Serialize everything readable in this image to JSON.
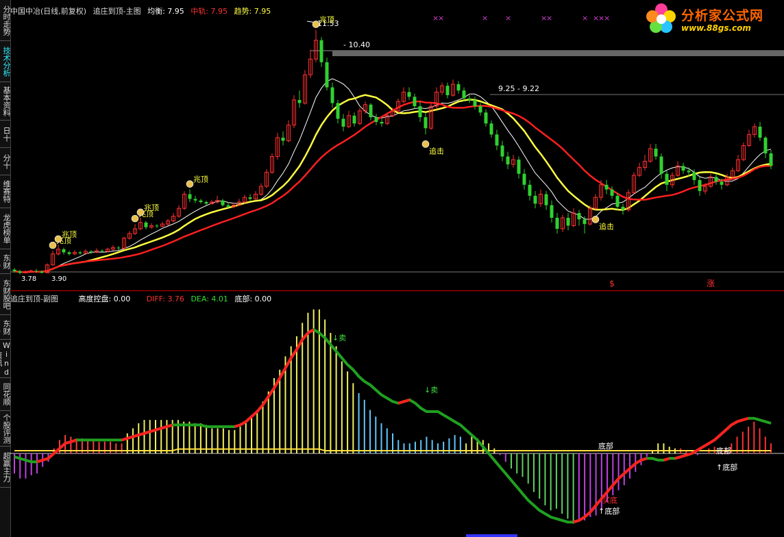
{
  "sidebar": {
    "items": [
      {
        "label": "分时走势",
        "active": false
      },
      {
        "label": "技术分析",
        "active": true
      },
      {
        "label": "基本资料",
        "active": false
      },
      {
        "label": "日十",
        "active": false
      },
      {
        "label": "分十",
        "active": false
      },
      {
        "label": "维赛特",
        "active": false
      },
      {
        "label": "龙虎榜单",
        "active": false
      },
      {
        "label": "东财10",
        "active": false
      },
      {
        "label": "东财股吧",
        "active": false
      },
      {
        "label": "东财F9",
        "active": false
      },
      {
        "label": "Wind资讯",
        "active": false
      },
      {
        "label": "同花顺",
        "active": false
      },
      {
        "label": "个股评测",
        "active": false
      },
      {
        "label": "超赢主力",
        "active": false
      }
    ]
  },
  "main_header": {
    "stock": "中国中冶(日线,前复权)",
    "indicator": "追庄到顶-主图",
    "avg_label": "均衡:",
    "avg_value": "7.95",
    "mid_label": "中轨:",
    "mid_value": "7.95",
    "trend_label": "趋势:",
    "trend_value": "7.95"
  },
  "sub_header": {
    "indicator": "追庄到顶-副图",
    "control_label": "高度控盘:",
    "control_value": "0.00",
    "diff_label": "DIFF:",
    "diff_value": "3.76",
    "dea_label": "DEA:",
    "dea_value": "4.01",
    "bottom_label": "底部:",
    "bottom_value": "0.00"
  },
  "logo": {
    "title": "分析家公式网",
    "url": "www.88gs.com"
  },
  "colors": {
    "up": "#ff3030",
    "down": "#30d030",
    "yellow": "#ffff40",
    "white": "#ffffff",
    "red": "#ff2020",
    "cyan": "#40c0ff",
    "magenta": "#d040d0",
    "grid": "#888888"
  },
  "chart_data": [
    {
      "type": "candlestick",
      "title": "追庄到顶-主图",
      "ylim": [
        3.5,
        12.0
      ],
      "price_markers": [
        {
          "text": "11.53"
        },
        {
          "text": "- 10.40"
        },
        {
          "text": "9.25 - 9.22"
        },
        {
          "text": "3.78"
        },
        {
          "text": "3.90"
        }
      ],
      "signals": [
        {
          "text": "兆顶",
          "idx": 7
        },
        {
          "text": "兆顶",
          "idx": 8
        },
        {
          "text": "兆顶",
          "idx": 22
        },
        {
          "text": "兆顶",
          "idx": 23
        },
        {
          "text": "兆顶",
          "idx": 32
        },
        {
          "text": "兆顶",
          "idx": 55
        },
        {
          "text": "追击",
          "idx": 75
        },
        {
          "text": "追击",
          "idx": 106
        }
      ],
      "bottom_flags": [
        {
          "text": "$",
          "idx": 109
        },
        {
          "text": "涨",
          "idx": 127
        }
      ],
      "candles": [
        [
          3.9,
          3.85,
          3.95,
          3.8
        ],
        [
          3.85,
          3.8,
          3.9,
          3.75
        ],
        [
          3.8,
          3.82,
          3.88,
          3.78
        ],
        [
          3.82,
          3.86,
          3.9,
          3.8
        ],
        [
          3.86,
          3.84,
          3.92,
          3.8
        ],
        [
          3.84,
          3.8,
          3.88,
          3.78
        ],
        [
          3.8,
          4.05,
          4.1,
          3.78
        ],
        [
          4.05,
          4.4,
          4.5,
          4.02
        ],
        [
          4.4,
          4.55,
          4.7,
          4.35
        ],
        [
          4.55,
          4.45,
          4.6,
          4.38
        ],
        [
          4.45,
          4.4,
          4.5,
          4.35
        ],
        [
          4.4,
          4.45,
          4.52,
          4.36
        ],
        [
          4.45,
          4.42,
          4.5,
          4.38
        ],
        [
          4.42,
          4.48,
          4.55,
          4.4
        ],
        [
          4.48,
          4.45,
          4.52,
          4.4
        ],
        [
          4.45,
          4.5,
          4.58,
          4.42
        ],
        [
          4.5,
          4.48,
          4.55,
          4.44
        ],
        [
          4.48,
          4.55,
          4.6,
          4.45
        ],
        [
          4.55,
          4.6,
          4.68,
          4.5
        ],
        [
          4.6,
          4.58,
          4.65,
          4.52
        ],
        [
          4.58,
          4.9,
          4.95,
          4.55
        ],
        [
          4.9,
          5.05,
          5.12,
          4.85
        ],
        [
          5.05,
          5.2,
          5.35,
          5.0
        ],
        [
          5.2,
          5.4,
          5.55,
          5.15
        ],
        [
          5.4,
          5.25,
          5.45,
          5.18
        ],
        [
          5.25,
          5.3,
          5.38,
          5.2
        ],
        [
          5.3,
          5.28,
          5.35,
          5.22
        ],
        [
          5.28,
          5.35,
          5.42,
          5.25
        ],
        [
          5.35,
          5.45,
          5.52,
          5.3
        ],
        [
          5.45,
          5.6,
          5.7,
          5.4
        ],
        [
          5.6,
          5.85,
          5.95,
          5.55
        ],
        [
          5.85,
          6.3,
          6.4,
          5.8
        ],
        [
          6.3,
          6.15,
          6.45,
          6.05
        ],
        [
          6.15,
          6.1,
          6.25,
          6.02
        ],
        [
          6.1,
          6.05,
          6.15,
          6.0
        ],
        [
          6.05,
          6.0,
          6.1,
          5.95
        ],
        [
          6.0,
          6.05,
          6.12,
          5.97
        ],
        [
          6.05,
          6.1,
          6.25,
          6.0
        ],
        [
          6.1,
          5.95,
          6.15,
          5.9
        ],
        [
          5.95,
          5.9,
          6.05,
          5.85
        ],
        [
          5.9,
          5.95,
          6.02,
          5.85
        ],
        [
          5.95,
          6.05,
          6.15,
          5.92
        ],
        [
          6.05,
          6.2,
          6.28,
          6.0
        ],
        [
          6.2,
          6.15,
          6.3,
          6.1
        ],
        [
          6.15,
          6.3,
          6.4,
          6.12
        ],
        [
          6.3,
          6.55,
          6.65,
          6.25
        ],
        [
          6.55,
          7.0,
          7.1,
          6.5
        ],
        [
          7.0,
          7.5,
          7.6,
          6.95
        ],
        [
          7.5,
          8.1,
          8.25,
          7.4
        ],
        [
          8.1,
          8.0,
          8.3,
          7.85
        ],
        [
          8.0,
          8.5,
          8.65,
          7.95
        ],
        [
          8.5,
          9.3,
          9.45,
          8.4
        ],
        [
          9.3,
          9.2,
          9.6,
          9.05
        ],
        [
          9.2,
          10.1,
          10.25,
          9.15
        ],
        [
          10.1,
          10.6,
          10.9,
          10.0
        ],
        [
          10.6,
          11.2,
          11.53,
          10.5
        ],
        [
          11.2,
          10.5,
          11.3,
          10.35
        ],
        [
          10.5,
          9.7,
          10.65,
          9.6
        ],
        [
          9.7,
          9.2,
          9.85,
          9.05
        ],
        [
          9.2,
          8.7,
          9.3,
          8.55
        ],
        [
          8.7,
          8.45,
          8.85,
          8.3
        ],
        [
          8.45,
          8.8,
          8.95,
          8.4
        ],
        [
          8.8,
          8.55,
          8.9,
          8.45
        ],
        [
          8.55,
          8.95,
          9.05,
          8.5
        ],
        [
          8.95,
          9.15,
          9.25,
          8.85
        ],
        [
          9.15,
          8.75,
          9.2,
          8.65
        ],
        [
          8.75,
          8.6,
          8.85,
          8.5
        ],
        [
          8.6,
          8.55,
          8.7,
          8.45
        ],
        [
          8.55,
          8.8,
          8.9,
          8.5
        ],
        [
          8.8,
          8.95,
          9.05,
          8.75
        ],
        [
          8.95,
          9.25,
          9.35,
          8.9
        ],
        [
          9.25,
          9.55,
          9.7,
          9.2
        ],
        [
          9.55,
          9.4,
          9.7,
          9.3
        ],
        [
          9.4,
          9.1,
          9.5,
          9.0
        ],
        [
          9.1,
          8.75,
          9.25,
          8.6
        ],
        [
          8.75,
          8.4,
          8.9,
          8.2
        ],
        [
          8.4,
          9.1,
          9.2,
          8.35
        ],
        [
          9.1,
          9.55,
          9.7,
          9.0
        ],
        [
          9.55,
          9.75,
          9.85,
          9.45
        ],
        [
          9.75,
          9.45,
          9.85,
          9.35
        ],
        [
          9.45,
          9.8,
          9.95,
          9.4
        ],
        [
          9.8,
          9.6,
          9.9,
          9.5
        ],
        [
          9.6,
          9.35,
          9.7,
          9.25
        ],
        [
          9.35,
          9.3,
          9.45,
          9.2
        ],
        [
          9.3,
          9.1,
          9.4,
          9.0
        ],
        [
          9.1,
          8.9,
          9.2,
          8.8
        ],
        [
          8.9,
          8.55,
          9.0,
          8.45
        ],
        [
          8.55,
          8.2,
          8.65,
          8.1
        ],
        [
          8.2,
          7.85,
          8.35,
          7.7
        ],
        [
          7.85,
          7.5,
          8.0,
          7.35
        ],
        [
          7.5,
          7.25,
          7.65,
          7.1
        ],
        [
          7.25,
          7.4,
          7.55,
          7.15
        ],
        [
          7.4,
          6.95,
          7.5,
          6.8
        ],
        [
          6.95,
          6.6,
          7.1,
          6.45
        ],
        [
          6.6,
          6.25,
          6.75,
          6.1
        ],
        [
          6.25,
          6.0,
          6.4,
          5.85
        ],
        [
          6.0,
          6.3,
          6.45,
          5.9
        ],
        [
          6.3,
          5.95,
          6.4,
          5.8
        ],
        [
          5.95,
          5.55,
          6.1,
          5.4
        ],
        [
          5.55,
          5.2,
          5.7,
          5.05
        ],
        [
          5.2,
          5.55,
          5.65,
          5.1
        ],
        [
          5.55,
          5.3,
          5.7,
          5.15
        ],
        [
          5.3,
          5.7,
          5.85,
          5.25
        ],
        [
          5.7,
          5.5,
          5.8,
          5.3
        ],
        [
          5.5,
          5.35,
          5.6,
          5.05
        ],
        [
          5.35,
          5.85,
          5.95,
          5.3
        ],
        [
          5.85,
          6.2,
          6.3,
          5.8
        ],
        [
          6.2,
          6.6,
          6.75,
          6.1
        ],
        [
          6.6,
          6.45,
          6.75,
          6.3
        ],
        [
          6.45,
          6.25,
          6.55,
          6.15
        ],
        [
          6.25,
          5.9,
          6.35,
          5.8
        ],
        [
          5.9,
          5.8,
          6.0,
          5.65
        ],
        [
          5.8,
          6.35,
          6.45,
          5.75
        ],
        [
          6.35,
          6.9,
          7.0,
          6.3
        ],
        [
          6.9,
          7.15,
          7.3,
          6.85
        ],
        [
          7.15,
          7.35,
          7.55,
          7.05
        ],
        [
          7.35,
          7.75,
          7.9,
          7.3
        ],
        [
          7.75,
          7.5,
          7.9,
          7.4
        ],
        [
          7.5,
          6.95,
          7.6,
          6.8
        ],
        [
          6.95,
          6.6,
          7.05,
          6.4
        ],
        [
          6.6,
          6.9,
          7.0,
          6.5
        ],
        [
          6.9,
          7.2,
          7.35,
          6.85
        ],
        [
          7.2,
          7.05,
          7.3,
          6.95
        ],
        [
          7.05,
          7.0,
          7.15,
          6.85
        ],
        [
          7.0,
          6.75,
          7.1,
          6.6
        ],
        [
          6.75,
          6.4,
          6.85,
          6.25
        ],
        [
          6.4,
          6.55,
          6.65,
          6.3
        ],
        [
          6.55,
          6.85,
          6.95,
          6.5
        ],
        [
          6.85,
          6.7,
          6.95,
          6.6
        ],
        [
          6.7,
          6.6,
          6.8,
          6.45
        ],
        [
          6.6,
          6.85,
          6.95,
          6.55
        ],
        [
          6.85,
          7.05,
          7.15,
          6.8
        ],
        [
          7.05,
          7.4,
          7.55,
          7.0
        ],
        [
          7.4,
          7.85,
          7.95,
          7.35
        ],
        [
          7.85,
          8.2,
          8.35,
          7.8
        ],
        [
          8.2,
          8.45,
          8.55,
          8.1
        ],
        [
          8.45,
          8.1,
          8.6,
          8.0
        ],
        [
          8.1,
          7.6,
          8.15,
          7.45
        ],
        [
          7.6,
          7.2,
          7.7,
          7.1
        ]
      ]
    },
    {
      "type": "bar",
      "title": "追庄到顶-副图",
      "ylim": [
        -4.5,
        9.0
      ],
      "labels": [
        {
          "text": "卖"
        },
        {
          "text": "卖"
        },
        {
          "text": "底部"
        },
        {
          "text": "底部"
        },
        {
          "text": "↑底部"
        },
        {
          "text": "↑底部"
        },
        {
          "text": "买底"
        }
      ],
      "macd": [
        -1.2,
        -1.5,
        -1.5,
        -1.3,
        -1.2,
        -0.8,
        -0.5,
        0.3,
        0.8,
        1.1,
        1.0,
        0.9,
        0.9,
        0.8,
        0.8,
        0.7,
        0.7,
        0.7,
        0.6,
        0.6,
        1.2,
        1.5,
        1.8,
        2.0,
        2.0,
        2.0,
        2.0,
        2.0,
        2.0,
        2.0,
        1.9,
        1.9,
        1.8,
        1.8,
        1.7,
        1.5,
        1.5,
        1.5,
        1.4,
        1.4,
        1.6,
        1.8,
        2.2,
        2.6,
        3.1,
        3.7,
        4.5,
        5.0,
        5.8,
        6.4,
        7.0,
        7.8,
        8.4,
        8.6,
        8.6,
        8.0,
        7.2,
        6.4,
        5.5,
        4.9,
        4.2,
        3.6,
        3.2,
        2.6,
        2.2,
        1.8,
        1.5,
        1.2,
        0.8,
        0.6,
        0.6,
        0.7,
        0.8,
        1.0,
        0.8,
        0.6,
        0.7,
        0.9,
        1.1,
        1.0,
        0.6,
        1.0,
        0.9,
        0.8,
        0.6,
        0.3,
        -0.1,
        -0.5,
        -0.9,
        -1.2,
        -1.4,
        -1.8,
        -2.3,
        -2.7,
        -3.1,
        -3.4,
        -3.3,
        -3.6,
        -3.9,
        -4.2,
        -4.0,
        -4.0,
        -3.8,
        -3.7,
        -3.3,
        -2.9,
        -2.5,
        -2.2,
        -1.9,
        -1.5,
        -1.1,
        -0.7,
        -0.2,
        0.2,
        0.6,
        0.6,
        0.4,
        0.3,
        0.3,
        0.2,
        0.1,
        -0.1,
        0.0,
        0.3,
        0.4,
        0.1,
        0.3,
        0.6,
        1.0,
        1.3,
        1.6,
        1.9,
        1.5,
        1.0,
        0.6
      ],
      "dea_line": [
        -0.2,
        -0.3,
        -0.4,
        -0.5,
        -0.5,
        -0.4,
        -0.3,
        0.0,
        0.3,
        0.6,
        0.7,
        0.8,
        0.8,
        0.8,
        0.8,
        0.8,
        0.8,
        0.8,
        0.8,
        0.8,
        0.9,
        1.0,
        1.1,
        1.2,
        1.3,
        1.4,
        1.5,
        1.6,
        1.7,
        1.7,
        1.7,
        1.7,
        1.7,
        1.7,
        1.6,
        1.6,
        1.6,
        1.6,
        1.6,
        1.6,
        1.7,
        1.9,
        2.2,
        2.5,
        2.9,
        3.4,
        3.9,
        4.5,
        5.1,
        5.7,
        6.2,
        6.8,
        7.2,
        7.4,
        7.2,
        6.9,
        6.5,
        6.1,
        5.7,
        5.3,
        5.0,
        4.6,
        4.3,
        4.1,
        3.8,
        3.5,
        3.3,
        3.1,
        3.0,
        3.1,
        3.2,
        3.0,
        2.7,
        2.5,
        2.5,
        2.5,
        2.3,
        2.1,
        1.9,
        1.7,
        1.4,
        1.1,
        0.8,
        0.4,
        0.0,
        -0.4,
        -0.8,
        -1.2,
        -1.6,
        -2.0,
        -2.4,
        -2.8,
        -3.1,
        -3.4,
        -3.6,
        -3.8,
        -3.9,
        -4.0,
        -4.1,
        -4.1,
        -4.0,
        -3.8,
        -3.5,
        -3.1,
        -2.7,
        -2.3,
        -1.9,
        -1.5,
        -1.2,
        -0.9,
        -0.6,
        -0.4,
        -0.3,
        -0.3,
        -0.4,
        -0.4,
        -0.3,
        -0.3,
        -0.2,
        -0.1,
        0.0,
        0.2,
        0.4,
        0.6,
        0.8,
        1.1,
        1.4,
        1.7,
        1.9,
        2.0,
        2.1,
        2.1,
        2.0,
        1.9,
        1.8
      ]
    }
  ]
}
